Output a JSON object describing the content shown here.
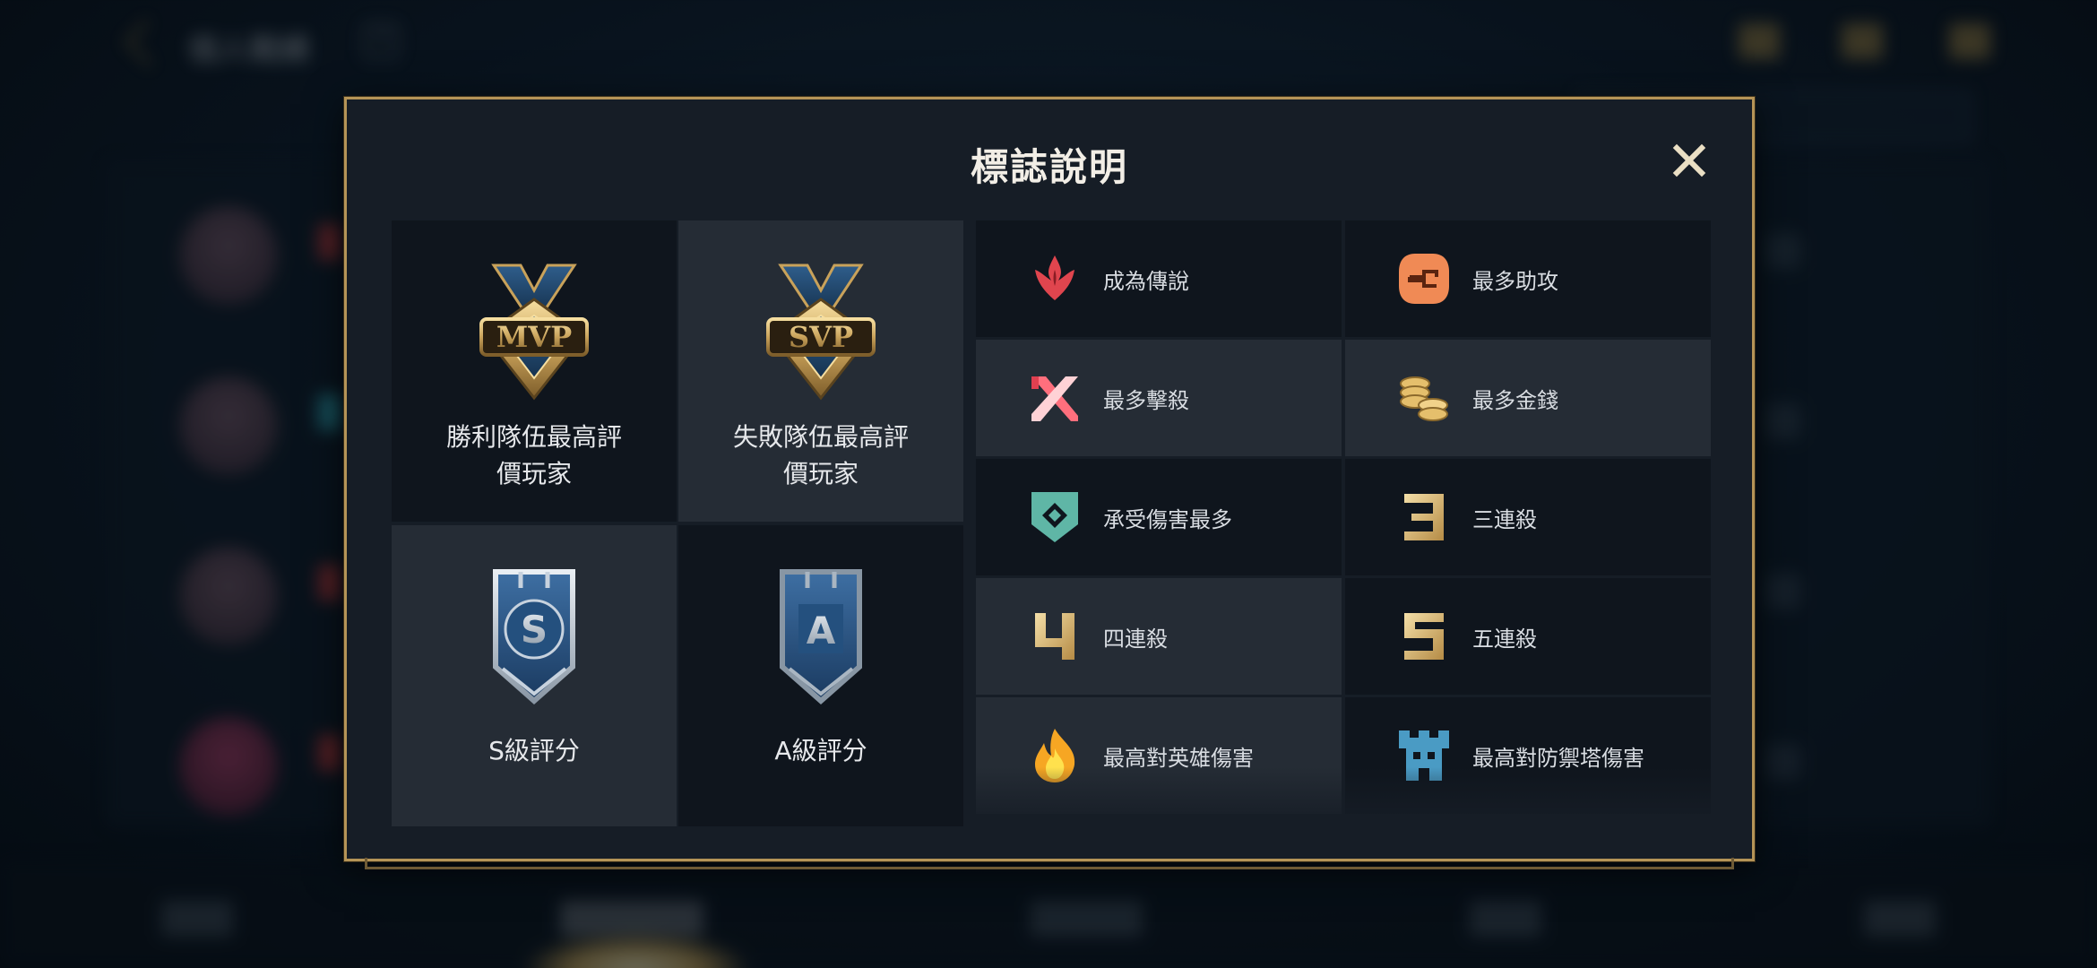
{
  "background": {
    "page_title": "個人戰績",
    "help_label": "?"
  },
  "modal": {
    "title": "標誌說明",
    "badges": [
      {
        "id": "mvp",
        "emblem_text": "MVP",
        "label_line1": "勝利隊伍最高評",
        "label_line2": "價玩家"
      },
      {
        "id": "svp",
        "emblem_text": "SVP",
        "label_line1": "失敗隊伍最高評",
        "label_line2": "價玩家"
      },
      {
        "id": "s_grade",
        "emblem_text": "S",
        "label": "S級評分"
      },
      {
        "id": "a_grade",
        "emblem_text": "A",
        "label": "A級評分"
      }
    ],
    "achievements": [
      {
        "icon": "legendary-icon",
        "label": "成為傳說"
      },
      {
        "icon": "assist-icon",
        "label": "最多助攻"
      },
      {
        "icon": "kills-icon",
        "label": "最多擊殺"
      },
      {
        "icon": "gold-coins-icon",
        "label": "最多金錢"
      },
      {
        "icon": "damage-taken-icon",
        "label": "承受傷害最多"
      },
      {
        "icon": "triple-kill-icon",
        "label": "三連殺",
        "glyph": "3"
      },
      {
        "icon": "quadra-kill-icon",
        "label": "四連殺",
        "glyph": "4"
      },
      {
        "icon": "penta-kill-icon",
        "label": "五連殺",
        "glyph": "5"
      },
      {
        "icon": "hero-damage-flame-icon",
        "label": "最高對英雄傷害"
      },
      {
        "icon": "tower-damage-icon",
        "label": "最高對防禦塔傷害"
      }
    ]
  },
  "colors": {
    "frame_gold": "#b59457",
    "legendary_red": "#e0454e",
    "assist_orange": "#f08a55",
    "gold_coin": "#e5bf6c",
    "tank_teal": "#5fb6a6",
    "tower_blue": "#4a9bc4"
  }
}
